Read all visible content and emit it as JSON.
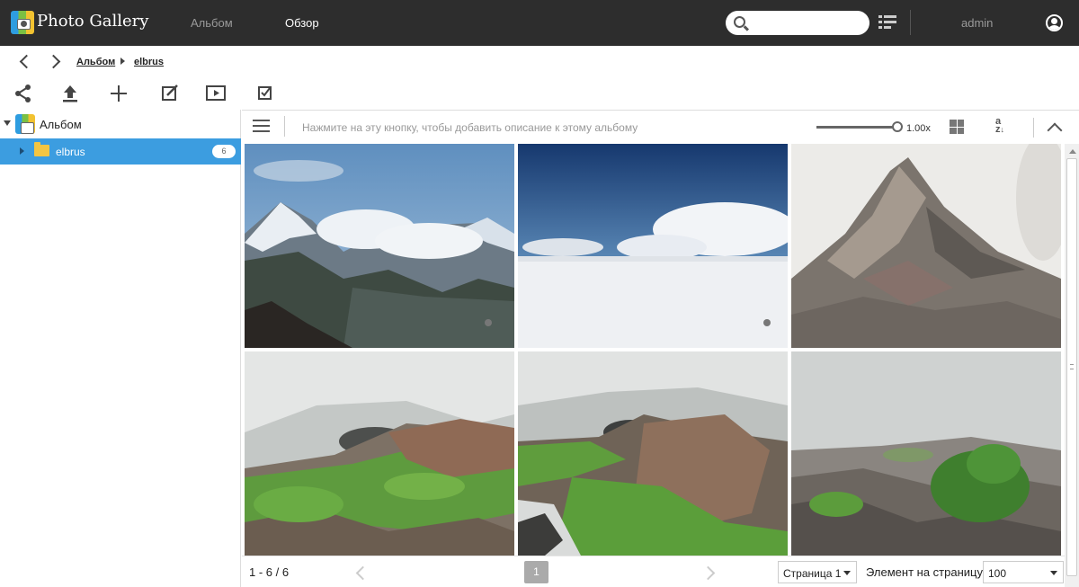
{
  "header": {
    "app_title": "Photo Gallery",
    "nav": [
      "Альбом",
      "Обзор"
    ],
    "search": {
      "value": ""
    },
    "user": "admin"
  },
  "breadcrumb": [
    "Альбом",
    "elbrus"
  ],
  "toolbar": {
    "icons": [
      "share-icon",
      "upload-icon",
      "add-icon",
      "edit-icon",
      "slideshow-icon",
      "select-icon"
    ]
  },
  "tree": {
    "root_label": "Альбом",
    "items": [
      {
        "label": "elbrus",
        "count": "6"
      }
    ]
  },
  "main": {
    "description_placeholder": "Нажмите на эту кнопку, чтобы добавить описание к этому альбому",
    "zoom": "1.00x",
    "zoom_level": 1.0
  },
  "photos": [
    {
      "subject": "snowy-mountain-peaks"
    },
    {
      "subject": "snowfield-with-clouds"
    },
    {
      "subject": "rocky-stone-pile"
    },
    {
      "subject": "misty-green-slope"
    },
    {
      "subject": "misty-rocks-and-stream"
    },
    {
      "subject": "misty-valley-with-bush"
    }
  ],
  "pagination": {
    "range": "1 - 6 / 6",
    "current_page": "1",
    "page_select": "Страница 1",
    "per_page_label": "Элемент на страницу",
    "per_page_value": "100"
  },
  "colors": {
    "topbar": "#2d2d2d",
    "selected_row": "#3c9de0",
    "page_button": "#aaaaaa"
  }
}
